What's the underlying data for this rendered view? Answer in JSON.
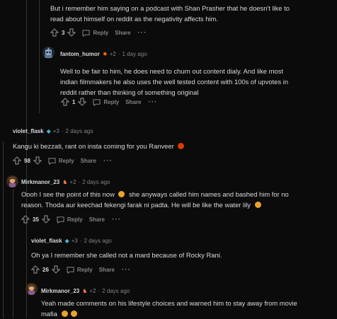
{
  "comments": [
    {
      "body_lines": [
        "But i remember him saying on a podcast with Shan Prasher that he doesn't like to",
        "read about himself on reddit as the negativity affects him."
      ],
      "votes": "3",
      "reply": "Reply",
      "share": "Share"
    },
    {
      "user": "fantom_humor",
      "flair": "+2",
      "time": "1 day ago",
      "body_lines": [
        "Well to be fair to him, he does need to churn out content dialy. And like most",
        "indian filmmakers he also uses the well tested content with 100s of upvotes in",
        "reddit rather than thinking of something original"
      ],
      "votes": "1",
      "reply": "Reply",
      "share": "Share"
    },
    {
      "user": "violet_flask",
      "flair": "+3",
      "time": "2 days ago",
      "body_lines": [
        "Kangu ki bezzati, rant on insta coming for you Ranveer"
      ],
      "votes": "98",
      "reply": "Reply",
      "share": "Share"
    },
    {
      "user": "Mirkmanor_23",
      "flair": "+2",
      "time": "2 days ago",
      "body_lines": [
        "Oooh I see the point of this now",
        "she anyways called him names and bashed him for no",
        "reason. Thoda aur keechad fekengi farak ni padta. He will be like the water lily"
      ],
      "votes": "35",
      "reply": "Reply",
      "share": "Share"
    },
    {
      "user": "violet_flask",
      "flair": "+3",
      "time": "2 days ago",
      "body_lines": [
        "Oh ya I remember she called not a mard because of Rocky Rani."
      ],
      "votes": "26",
      "reply": "Reply",
      "share": "Share"
    },
    {
      "user": "Mirkmanor_23",
      "flair": "+2",
      "time": "2 days ago",
      "body_lines": [
        "Yeah made comments on his lifestyle choices and warned him to stay away from movie",
        "mafia"
      ]
    }
  ],
  "colors": {
    "background": "#0b0b0b",
    "text": "#d7dadc",
    "muted": "#818384",
    "thread": "#343536",
    "emoji": "#e7a32c",
    "angry": "#d93a00"
  }
}
